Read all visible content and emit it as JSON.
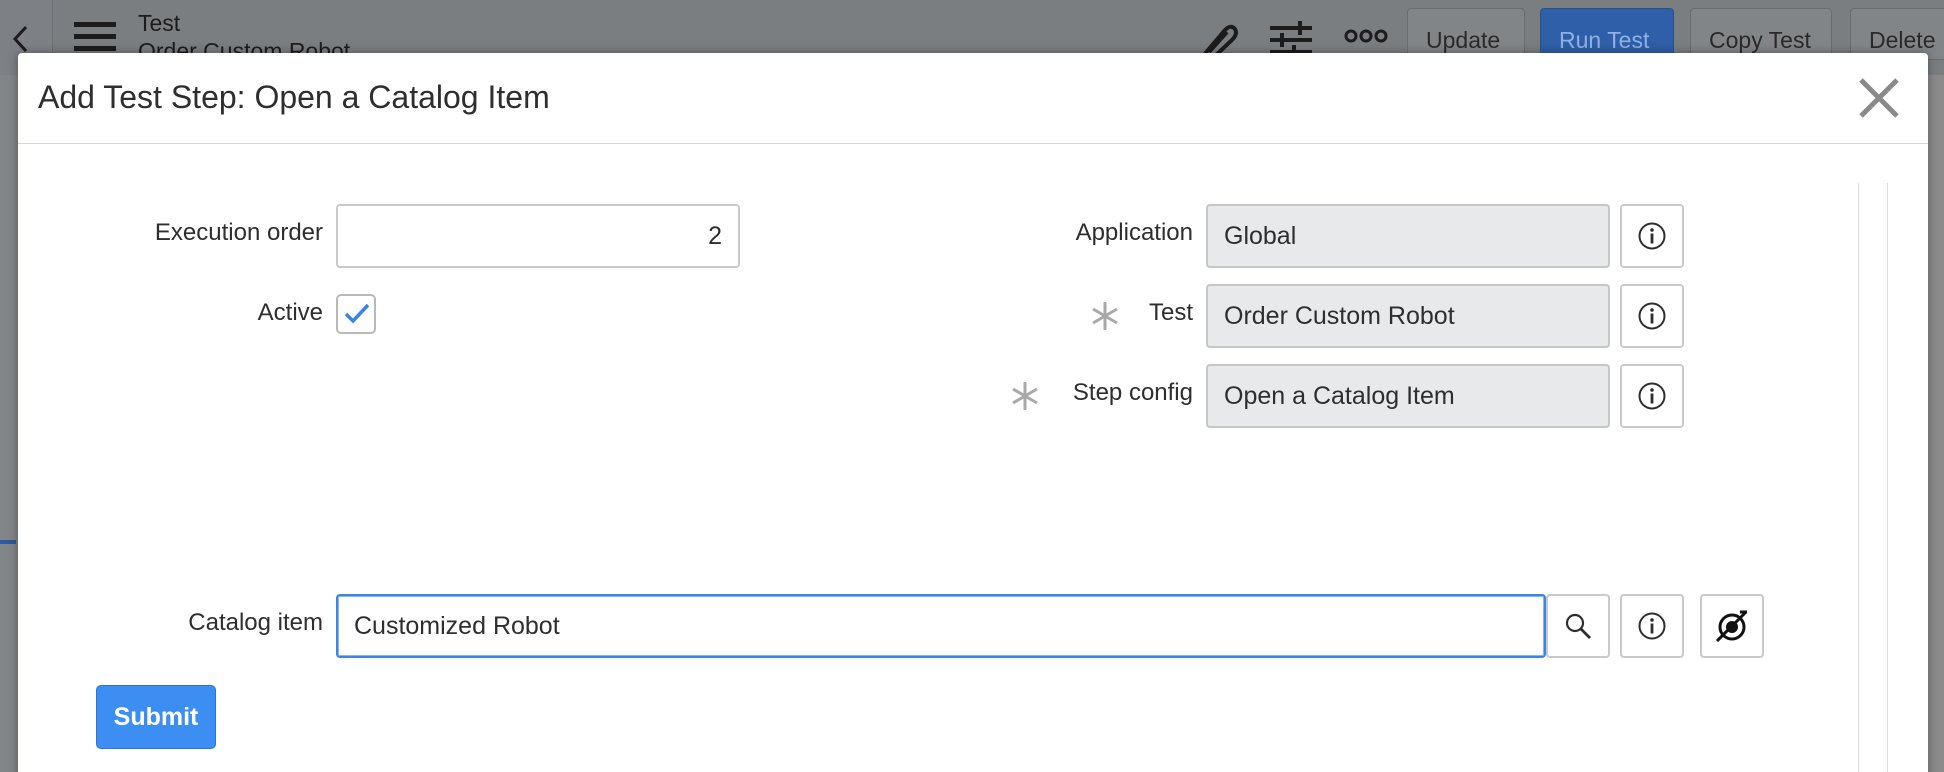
{
  "background_header": {
    "title": "Test",
    "subtitle": "Order Custom Robot",
    "buttons": {
      "update": "Update",
      "run_test": "Run Test",
      "copy_test": "Copy Test",
      "delete": "Delete"
    }
  },
  "modal": {
    "title": "Add Test Step: Open a Catalog Item",
    "fields": {
      "execution_order": {
        "label": "Execution order",
        "value": "2"
      },
      "active": {
        "label": "Active",
        "checked": true
      },
      "application": {
        "label": "Application",
        "value": "Global"
      },
      "test": {
        "label": "Test",
        "value": "Order Custom Robot",
        "required": true
      },
      "step_config": {
        "label": "Step config",
        "value": "Open a Catalog Item",
        "required": true
      },
      "catalog_item": {
        "label": "Catalog item",
        "value": "Customized Robot"
      }
    },
    "submit_label": "Submit"
  },
  "colors": {
    "primary": "#3c8ef3",
    "focus_border": "#3b84e6",
    "readonly_bg": "#e8e9ea",
    "check": "#3b84e6"
  },
  "icons": {
    "back": "chevron-left-icon",
    "menu": "hamburger-icon",
    "attachment": "paperclip-icon",
    "settings": "sliders-icon",
    "more": "more-dots-icon",
    "close": "close-icon",
    "info": "info-icon",
    "search": "search-icon",
    "preview": "preview-reference-icon"
  }
}
